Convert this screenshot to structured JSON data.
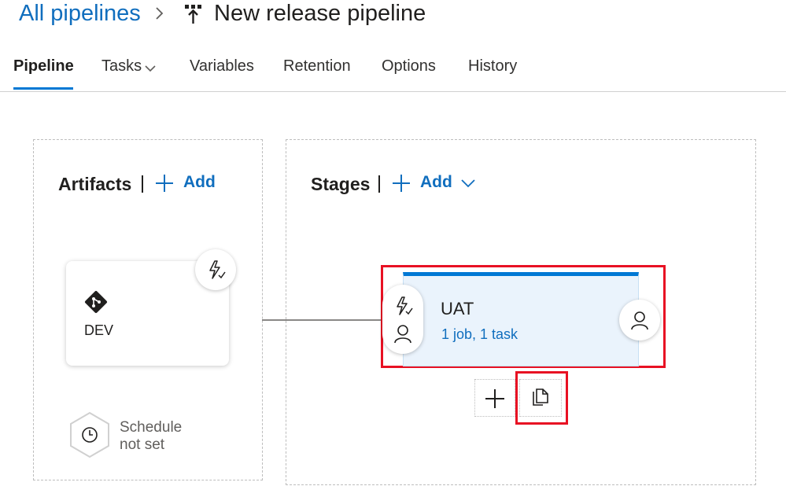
{
  "breadcrumb": {
    "parent": "All pipelines",
    "separator_icon": "chevron-right-icon",
    "pipeline_icon": "release-pipeline-icon",
    "title": "New release pipeline"
  },
  "tabs": [
    {
      "label": "Pipeline",
      "active": true
    },
    {
      "label": "Tasks",
      "dropdown": true
    },
    {
      "label": "Variables"
    },
    {
      "label": "Retention"
    },
    {
      "label": "Options"
    },
    {
      "label": "History"
    }
  ],
  "artifacts": {
    "title": "Artifacts",
    "add_label": "Add",
    "card": {
      "name": "DEV",
      "source_icon": "git-icon",
      "trigger_icon": "lightning-icon"
    },
    "schedule": {
      "icon": "clock-icon",
      "line1": "Schedule",
      "line2": "not set"
    }
  },
  "stages": {
    "title": "Stages",
    "add_label": "Add",
    "add_dropdown_icon": "chevron-down-icon",
    "items": [
      {
        "name": "UAT",
        "summary": "1 job, 1 task",
        "pre_deployment_icons": [
          "lightning-icon",
          "person-icon"
        ],
        "post_deployment_icon": "person-icon"
      }
    ],
    "actions": {
      "add_icon": "plus-icon",
      "clone_icon": "clone-icon"
    }
  },
  "colors": {
    "accent": "#0078d4",
    "link": "#106ebe",
    "highlight": "#e81123",
    "stage_bg": "#eaf3fc"
  }
}
